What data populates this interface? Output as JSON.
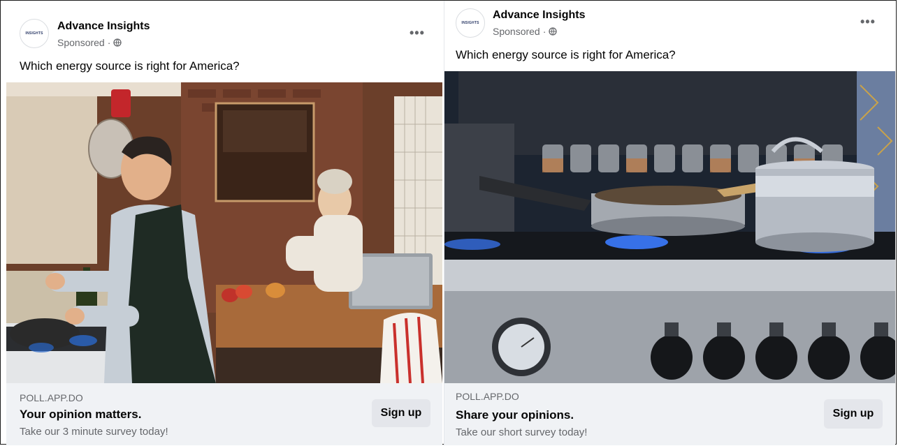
{
  "ads": [
    {
      "page_name": "Advance Insights",
      "avatar_logo": "INSIGHTS",
      "sponsored": "Sponsored",
      "separator": "·",
      "more": "•••",
      "caption": "Which energy source is right for America?",
      "domain": "POLL.APP.DO",
      "headline": "Your opinion matters.",
      "subtext": "Take our 3 minute survey today!",
      "cta": "Sign up"
    },
    {
      "page_name": "Advance Insights",
      "avatar_logo": "INSIGHTS",
      "sponsored": "Sponsored",
      "separator": "·",
      "more": "•••",
      "caption": "Which energy source is right for America?",
      "domain": "POLL.APP.DO",
      "headline": "Share your opinions.",
      "subtext": "Take our short survey today!",
      "cta": "Sign up"
    }
  ],
  "colors": {
    "text_primary": "#050505",
    "text_secondary": "#65676b",
    "footer_bg": "#f0f2f5",
    "button_bg": "#e4e6eb"
  },
  "images": [
    {
      "subject": "kitchen scene with man cooking at gas stove and woman at counter with laptop"
    },
    {
      "subject": "stainless steel gas stove with blue flames, frying pan and pot"
    }
  ]
}
